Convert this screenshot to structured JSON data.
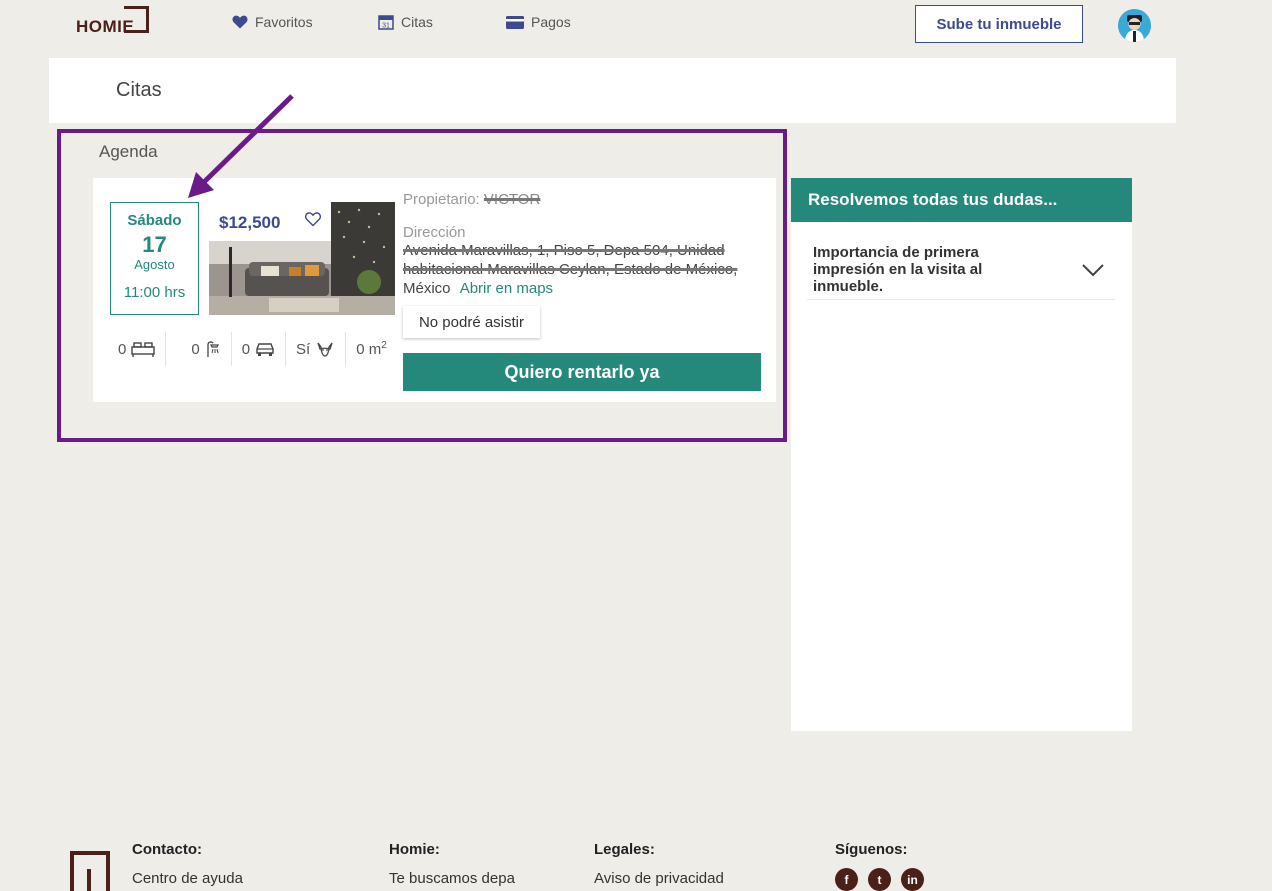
{
  "header": {
    "logo_text": "HOMIE",
    "nav": [
      {
        "label": "Favoritos",
        "icon": "heart-icon"
      },
      {
        "label": "Citas",
        "icon": "calendar-icon"
      },
      {
        "label": "Pagos",
        "icon": "card-icon"
      }
    ],
    "cta_label": "Sube tu inmueble"
  },
  "page_title": "Citas",
  "agenda": {
    "label": "Agenda",
    "appointment": {
      "weekday": "Sábado",
      "day": "17",
      "month": "Agosto",
      "time": "11:00 hrs",
      "price": "$12,500",
      "features": {
        "bedrooms": "0",
        "bathrooms": "0",
        "parking": "0",
        "pets": "Sí",
        "area": "0 m",
        "area_sup": "2"
      },
      "owner_label": "Propietario:",
      "owner_name": "VICTOR",
      "address_label": "Dirección",
      "address_line1": "Avenida Maravillas, 1, Piso 5, Depa 504, Unidad",
      "address_line2": "habitacional Maravillas Ceylan, Estado de México,",
      "address_line3": "México",
      "maps_link": "Abrir en maps",
      "cancel_label": "No podré asistir",
      "rent_label": "Quiero rentarlo ya"
    }
  },
  "faq": {
    "title": "Resolvemos todas tus dudas...",
    "items": [
      {
        "question": "Importancia de primera impresión en la visita al inmueble."
      }
    ]
  },
  "footer": {
    "contact_head": "Contacto:",
    "contact_link": "Centro de ayuda",
    "homie_head": "Homie:",
    "homie_link": "Te buscamos depa",
    "legal_head": "Legales:",
    "legal_link": "Aviso de privacidad",
    "social_head": "Síguenos:",
    "social": [
      "f",
      "t",
      "in"
    ]
  },
  "colors": {
    "brand": "#4a2018",
    "accent": "#24897b",
    "primary_blue": "#3d4a8f",
    "highlight": "#6a1b8a"
  }
}
